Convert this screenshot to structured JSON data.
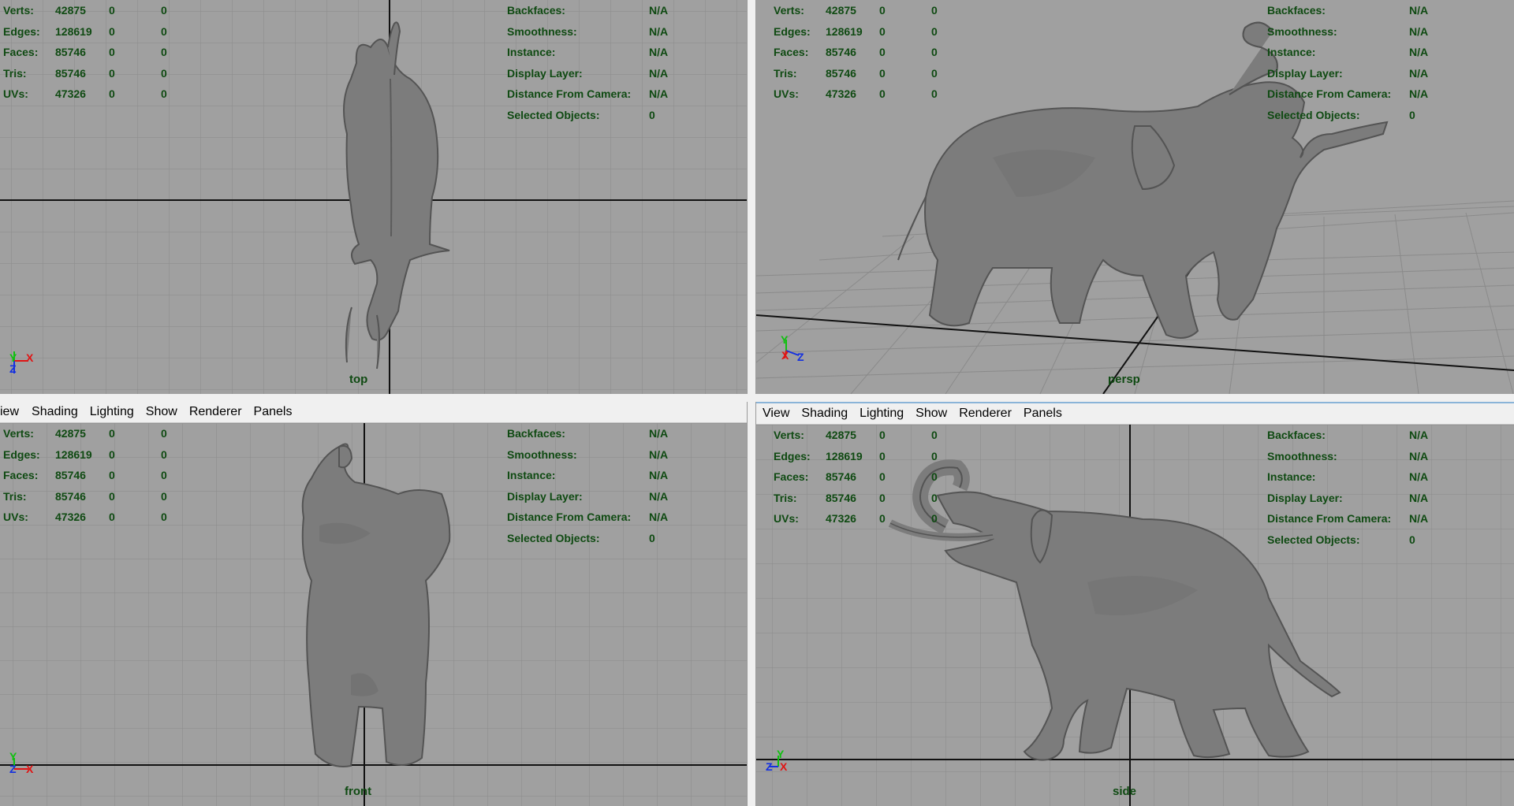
{
  "hud": {
    "labels": [
      "Verts:",
      "Edges:",
      "Faces:",
      "Tris:",
      "UVs:"
    ],
    "values": [
      "42875",
      "128619",
      "85746",
      "85746",
      "47326"
    ],
    "zero": "0",
    "right_labels": [
      "Backfaces:",
      "Smoothness:",
      "Instance:",
      "Display Layer:",
      "Distance From Camera:",
      "Selected Objects:"
    ],
    "right_values": [
      "N/A",
      "N/A",
      "N/A",
      "N/A",
      "N/A",
      "0"
    ]
  },
  "menu": {
    "front": [
      "iew",
      "Shading",
      "Lighting",
      "Show",
      "Renderer",
      "Panels"
    ],
    "side": [
      "View",
      "Shading",
      "Lighting",
      "Show",
      "Renderer",
      "Panels"
    ]
  },
  "viewports": {
    "top": {
      "camera": "top"
    },
    "persp": {
      "camera": "persp"
    },
    "front": {
      "camera": "front"
    },
    "side": {
      "camera": "side"
    }
  },
  "axes": {
    "top": [
      "Y",
      "X",
      "Z"
    ],
    "persp": [
      "Y",
      "X",
      "Z"
    ],
    "front": [
      "Y",
      "Z",
      "X"
    ],
    "side": [
      "Y",
      "Z",
      "X"
    ]
  },
  "colors": {
    "viewport_bg": "#a0a0a0",
    "grid": "#8a8a8a",
    "hud_text": "#0f4a12",
    "mesh": "#7c7c7c",
    "axis_x": "#e01414",
    "axis_y": "#10c010",
    "axis_z": "#1430e0"
  },
  "icons": [
    "axis-gizmo-icon"
  ]
}
